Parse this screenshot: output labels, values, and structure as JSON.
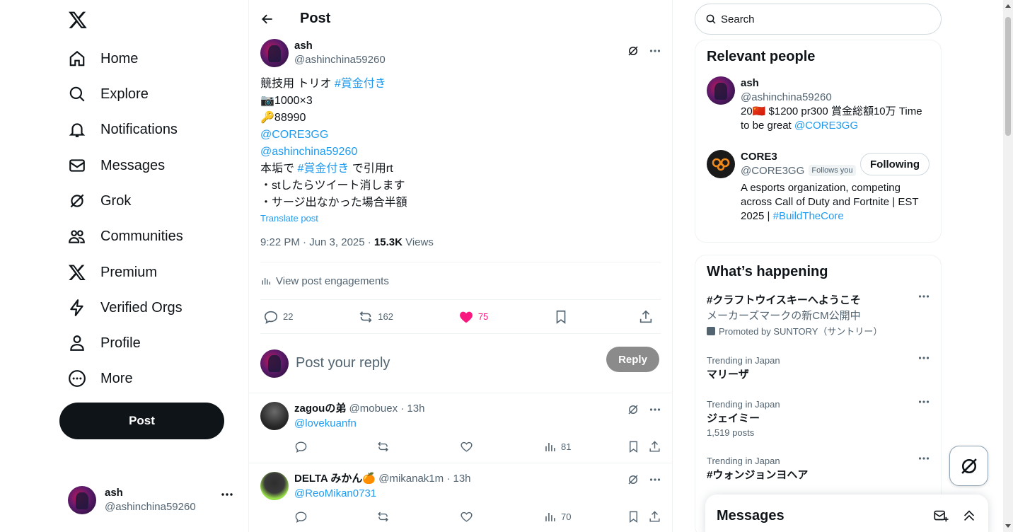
{
  "nav": {
    "items": [
      {
        "label": "Home",
        "icon": "home-icon"
      },
      {
        "label": "Explore",
        "icon": "search-icon"
      },
      {
        "label": "Notifications",
        "icon": "bell-icon"
      },
      {
        "label": "Messages",
        "icon": "envelope-icon"
      },
      {
        "label": "Grok",
        "icon": "grok-icon"
      },
      {
        "label": "Communities",
        "icon": "people-icon"
      },
      {
        "label": "Premium",
        "icon": "x-logo-icon"
      },
      {
        "label": "Verified Orgs",
        "icon": "lightning-icon"
      },
      {
        "label": "Profile",
        "icon": "person-icon"
      },
      {
        "label": "More",
        "icon": "more-circle-icon"
      }
    ],
    "post_label": "Post",
    "account": {
      "name": "ash",
      "handle": "@ashinchina59260"
    }
  },
  "main": {
    "title": "Post",
    "tweet": {
      "name": "ash",
      "handle": "@ashinchina59260",
      "lines": {
        "l1_text": "競技用 トリオ ",
        "l1_tag": "#賞金付き",
        "l2": "📷1000×3",
        "l3": "🔑88990",
        "l4": "@CORE3GG",
        "l5": "@ashinchina59260",
        "l6_pre": "本垢で ",
        "l6_tag": "#賞金付き",
        "l6_post": " で引用rt",
        "l7": "・stしたらツイート消します",
        "l8": "・サージ出なかった場合半額"
      },
      "translate": "Translate post",
      "time": "9:22 PM · Jun 3, 2025 · ",
      "views_count": "15.3K",
      "views_label": " Views",
      "engagements": "View post engagements",
      "replies": "22",
      "reposts": "162",
      "likes": "75"
    },
    "reply_placeholder": "Post your reply",
    "reply_button": "Reply",
    "replies": [
      {
        "name": "zagouの弟",
        "meta": " @mobuex · 13h",
        "text": "@lovekuanfn",
        "views": "81"
      },
      {
        "name": "DELTA みかん🍊",
        "meta": " @mikanak1m · 13h",
        "text": "@ReoMikan0731",
        "views": "70"
      }
    ]
  },
  "right": {
    "search_placeholder": "Search",
    "relevant_title": "Relevant people",
    "people": [
      {
        "name": "ash",
        "handle": "@ashinchina59260",
        "bio_text": "20🇨🇳 $1200 pr300 賞金総額10万 Time to be great ",
        "bio_link": "@CORE3GG"
      },
      {
        "name": "CORE3",
        "handle": "@CORE3GG",
        "badge": "Follows you",
        "button": "Following",
        "bio_text": "A esports organization, competing across Call of Duty and Fortnite | EST 2025 | ",
        "bio_link": "#BuildTheCore"
      }
    ],
    "happening_title": "What’s happening",
    "trends": [
      {
        "name": "#クラフトウイスキーへようこそ",
        "sub": "メーカーズマークの新CM公開中",
        "promo": "Promoted by SUNTORY（サントリー）"
      },
      {
        "context": "Trending in Japan",
        "name": "マリーザ"
      },
      {
        "context": "Trending in Japan",
        "name": "ジェイミー",
        "count": "1,519 posts"
      },
      {
        "context": "Trending in Japan",
        "name": "#ウォンジョンヨヘア"
      }
    ],
    "messages_title": "Messages"
  }
}
